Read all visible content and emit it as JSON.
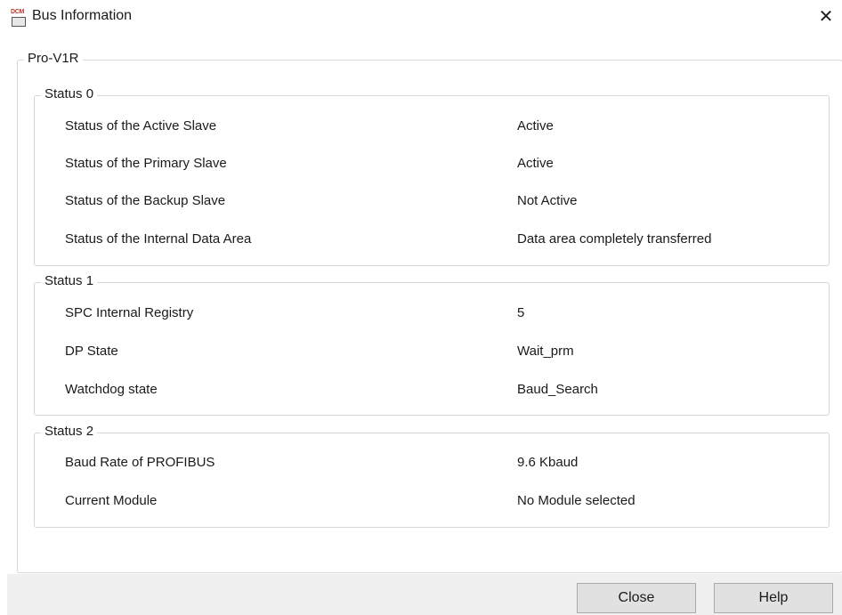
{
  "window": {
    "title": "Bus Information",
    "icon_text": "DCM"
  },
  "device": {
    "name": "Pro-V1R"
  },
  "status0": {
    "title": "Status 0",
    "rows": [
      {
        "label": "Status of the Active Slave",
        "value": "Active"
      },
      {
        "label": "Status of the Primary Slave",
        "value": "Active"
      },
      {
        "label": "Status of the Backup Slave",
        "value": "Not Active"
      },
      {
        "label": "Status of the Internal Data Area",
        "value": "Data area completely transferred"
      }
    ]
  },
  "status1": {
    "title": "Status 1",
    "rows": [
      {
        "label": "SPC Internal Registry",
        "value": "5"
      },
      {
        "label": "DP State",
        "value": "Wait_prm"
      },
      {
        "label": "Watchdog state",
        "value": "Baud_Search"
      }
    ]
  },
  "status2": {
    "title": "Status 2",
    "rows": [
      {
        "label": "Baud Rate of PROFIBUS",
        "value": "9.6 Kbaud"
      },
      {
        "label": "Current Module",
        "value": "No Module selected"
      }
    ]
  },
  "buttons": {
    "close": "Close",
    "help": "Help"
  }
}
